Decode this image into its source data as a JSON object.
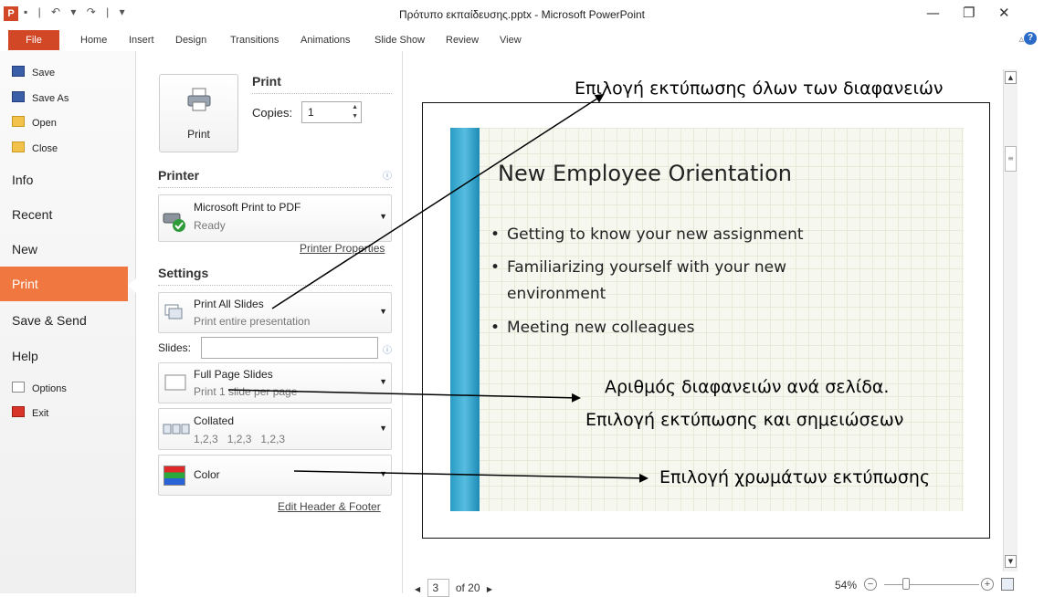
{
  "window": {
    "title": "Πρότυπο εκπαίδευσης.pptx - Microsoft PowerPoint",
    "app_icon": "P",
    "qat": "▪ | ↶ ▾ ↷ | ▾",
    "minimize": "—",
    "maximize": "❐",
    "close": "✕"
  },
  "ribbon": {
    "file_tab": "File",
    "tabs": [
      "Home",
      "Insert",
      "Design",
      "Transitions",
      "Animations",
      "Slide Show",
      "Review",
      "View"
    ],
    "collapse": "▵",
    "help": "?"
  },
  "backstage": {
    "small_items": [
      {
        "label": "Save",
        "icon": "save-icon"
      },
      {
        "label": "Save As",
        "icon": "save-as-icon"
      },
      {
        "label": "Open",
        "icon": "open-folder-icon"
      },
      {
        "label": "Close",
        "icon": "close-folder-icon"
      }
    ],
    "items": [
      "Info",
      "Recent",
      "New",
      "Print",
      "Save & Send",
      "Help"
    ],
    "selected": "Print",
    "bottom_items": [
      {
        "label": "Options",
        "icon": "options-icon"
      },
      {
        "label": "Exit",
        "icon": "exit-icon"
      }
    ]
  },
  "print_panel": {
    "print_button": "Print",
    "print_heading": "Print",
    "copies_label": "Copies:",
    "copies_value": "1",
    "printer_heading": "Printer",
    "printer_name": "Microsoft Print to PDF",
    "printer_status": "Ready",
    "printer_properties": "Printer Properties",
    "settings_heading": "Settings",
    "what_to_print": {
      "title": "Print All Slides",
      "subtitle": "Print entire presentation"
    },
    "slides_label": "Slides:",
    "slides_value": "",
    "layout": {
      "title": "Full Page Slides",
      "subtitle": "Print 1 slide per page"
    },
    "collation": {
      "title": "Collated",
      "subtitle": "1,2,3   1,2,3   1,2,3"
    },
    "color": {
      "title": "Color"
    },
    "edit_header_footer": "Edit Header & Footer"
  },
  "slide": {
    "title": "New Employee Orientation",
    "bullets": [
      "Getting to know your new assignment",
      "Familiarizing yourself with your new",
      "environment",
      "Meeting new colleagues"
    ]
  },
  "annotations": {
    "print_all": "Επιλογή εκτύπωσης όλων των διαφανειών",
    "per_page_1": "Αριθμός διαφανειών ανά σελίδα.",
    "per_page_2": "Επιλογή εκτύπωσης και σημειώσεων",
    "color": "Επιλογή χρωμάτων εκτύπωσης"
  },
  "pager": {
    "current": "3",
    "of_label": "of 20",
    "prev": "◀",
    "next": "▶"
  },
  "zoom": {
    "level": "54%",
    "minus": "−",
    "plus": "+"
  },
  "colors": {
    "accent": "#d24726",
    "print_selected": "#f07840",
    "slide_bar": "#2a9cc4"
  }
}
